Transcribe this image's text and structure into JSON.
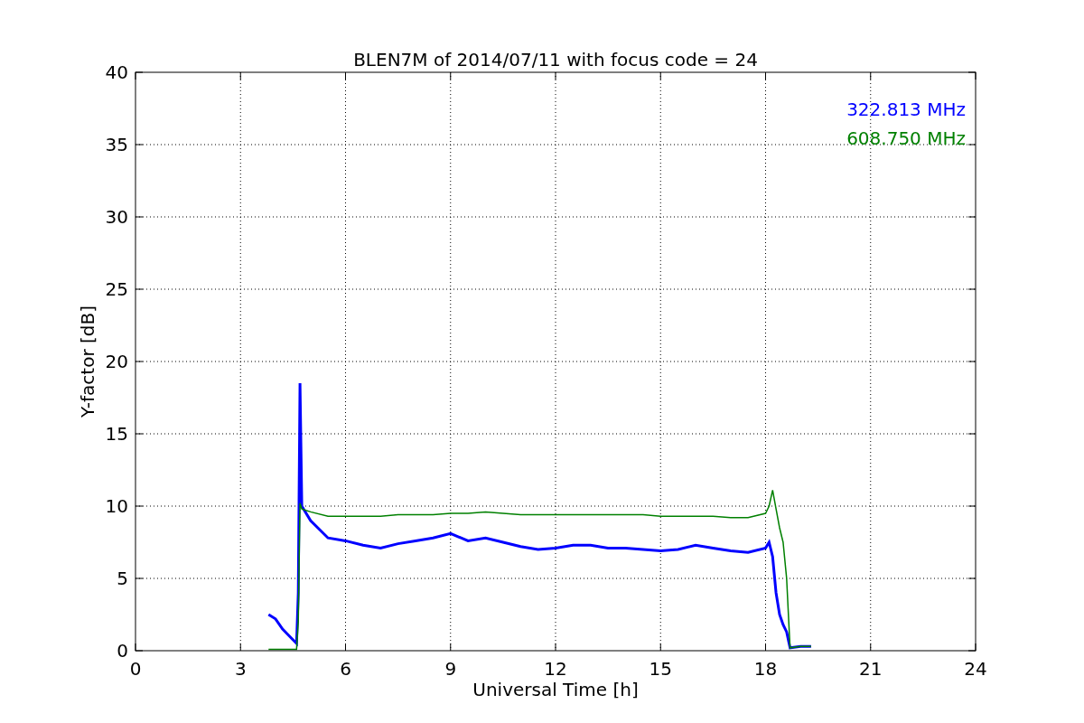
{
  "figure": {
    "chart_data": {
      "type": "line",
      "title": "BLEN7M of 2014/07/11 with focus code = 24",
      "xlabel": "Universal Time [h]",
      "ylabel": "Y-factor [dB]",
      "x": [
        3.8,
        4.0,
        4.2,
        4.4,
        4.6,
        4.65,
        4.7,
        4.75,
        5,
        5.5,
        6,
        6.5,
        7,
        7.5,
        8,
        8.5,
        9,
        9.5,
        10,
        10.5,
        11,
        11.5,
        12,
        12.5,
        13,
        13.5,
        14,
        14.5,
        15,
        15.5,
        16,
        16.5,
        17,
        17.5,
        18,
        18.1,
        18.2,
        18.3,
        18.4,
        18.5,
        18.6,
        18.7,
        19,
        19.3
      ],
      "series": [
        {
          "name": "322.813 MHz",
          "color": "#0000ff",
          "values": [
            2.5,
            2.2,
            1.5,
            1.0,
            0.5,
            4.0,
            18.5,
            10.0,
            9.0,
            7.8,
            7.6,
            7.3,
            7.1,
            7.4,
            7.6,
            7.8,
            8.1,
            7.6,
            7.8,
            7.5,
            7.2,
            7.0,
            7.1,
            7.3,
            7.3,
            7.1,
            7.1,
            7.0,
            6.9,
            7.0,
            7.3,
            7.1,
            6.9,
            6.8,
            7.1,
            7.5,
            6.5,
            4.0,
            2.5,
            1.8,
            1.3,
            0.2,
            0.3,
            0.3
          ]
        },
        {
          "name": "608.750 MHz",
          "color": "#008000",
          "values": [
            0.1,
            0.1,
            0.1,
            0.1,
            0.1,
            2.0,
            10.2,
            9.8,
            9.6,
            9.3,
            9.3,
            9.3,
            9.3,
            9.4,
            9.4,
            9.4,
            9.5,
            9.5,
            9.6,
            9.5,
            9.4,
            9.4,
            9.4,
            9.4,
            9.4,
            9.4,
            9.4,
            9.4,
            9.3,
            9.3,
            9.3,
            9.3,
            9.2,
            9.2,
            9.5,
            10.0,
            11.1,
            9.8,
            8.5,
            7.5,
            5.0,
            0.2,
            0.3,
            0.3
          ]
        }
      ],
      "grid": true,
      "xlim": [
        0,
        24
      ],
      "ylim": [
        0,
        40
      ],
      "xticks": [
        0,
        3,
        6,
        9,
        12,
        15,
        18,
        21,
        24
      ],
      "yticks": [
        0,
        5,
        10,
        15,
        20,
        25,
        30,
        35,
        40
      ]
    }
  }
}
